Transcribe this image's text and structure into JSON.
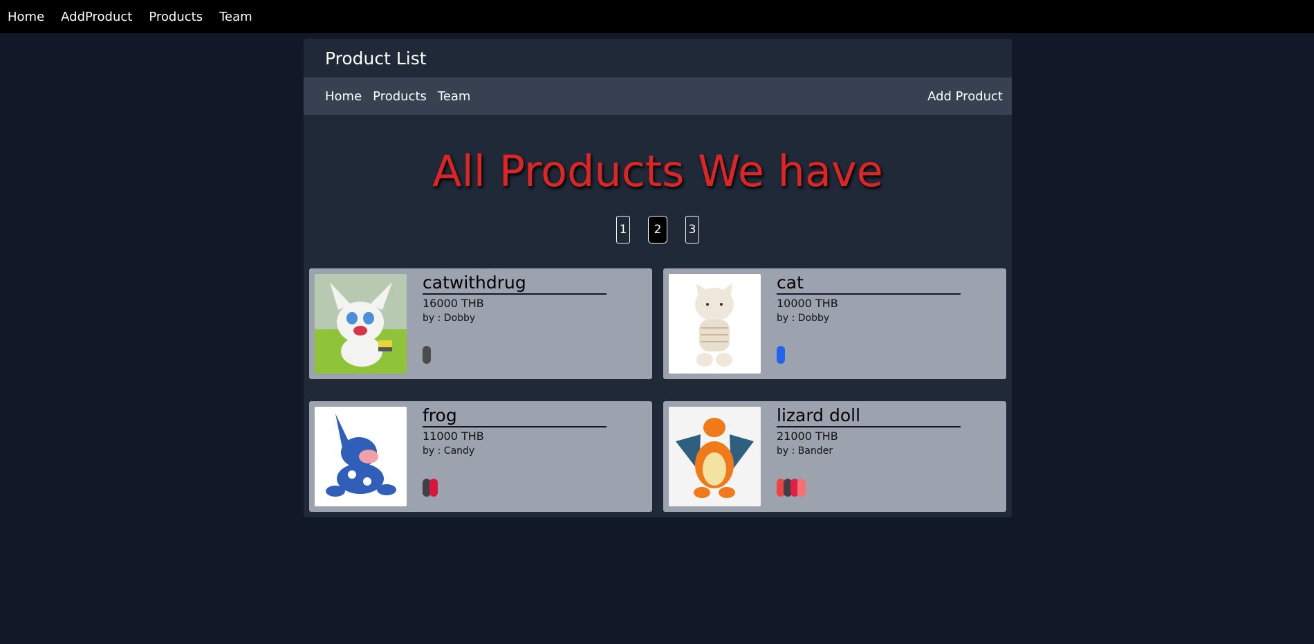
{
  "topnav": {
    "items": [
      "Home",
      "AddProduct",
      "Products",
      "Team"
    ]
  },
  "panel": {
    "title": "Product List",
    "subnav": {
      "left": [
        "Home",
        "Products",
        "Team"
      ],
      "right": "Add Product"
    },
    "heading": "All Products We have",
    "pagination": {
      "pages": [
        "1",
        "2",
        "3"
      ],
      "current": "2"
    }
  },
  "products": [
    {
      "name": "catwithdrug",
      "price": "16000 THB",
      "by": "by : Dobby",
      "image": "gatomon-plush-image",
      "colors": [
        "#4b4b4b"
      ]
    },
    {
      "name": "cat",
      "price": "10000 THB",
      "by": "by : Dobby",
      "image": "cat-plush-image",
      "colors": [
        "#2563eb"
      ]
    },
    {
      "name": "frog",
      "price": "11000 THB",
      "by": "by : Candy",
      "image": "greninja-plush-image",
      "colors": [
        "#3f3f46",
        "#dc143c"
      ]
    },
    {
      "name": "lizard doll",
      "price": "21000 THB",
      "by": "by : Bander",
      "image": "charizard-plush-image",
      "colors": [
        "#ef4444",
        "#3f3f46",
        "#e11d48",
        "#f87171"
      ]
    }
  ],
  "theme": {
    "background": "#111827",
    "panel": "#1f2937",
    "subnav": "#374151",
    "card": "#9ca3af",
    "heading": "#dc2626"
  }
}
